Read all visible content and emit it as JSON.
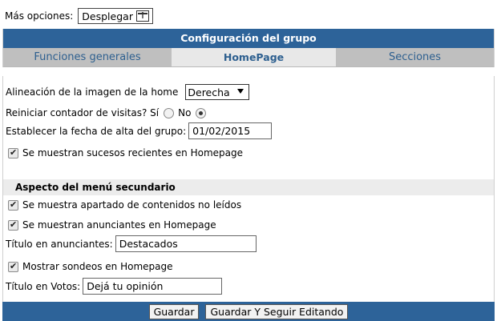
{
  "top": {
    "label": "Más opciones:",
    "expand_button": "Desplegar"
  },
  "panel": {
    "title": "Configuración del grupo",
    "tabs": [
      {
        "label": "Funciones generales"
      },
      {
        "label": "HomePage"
      },
      {
        "label": "Secciones"
      }
    ]
  },
  "home": {
    "image_align_label": "Alineación de la imagen de la home",
    "image_align_value": "Derecha",
    "reset_label": "Reiniciar contador de visitas? Sí",
    "reset_no": "No",
    "date_label": "Establecer la fecha de alta del grupo:",
    "date_value": "01/02/2015",
    "recent_label": "Se muestran sucesos recientes en Homepage"
  },
  "menu": {
    "section_title": "Aspecto del menú secundario",
    "unread_label": "Se muestra apartado de contenidos no leídos",
    "advertisers_label": "Se muestran anunciantes en Homepage",
    "advertisers_title_label": "Título en anunciantes:",
    "advertisers_title_value": "Destacados",
    "polls_label": "Mostrar sondeos en Homepage",
    "votes_title_label": "Título en Votos:",
    "votes_title_value": "Dejá tu opinión"
  },
  "footer": {
    "save": "Guardar",
    "save_continue": "Guardar Y Seguir Editando"
  }
}
